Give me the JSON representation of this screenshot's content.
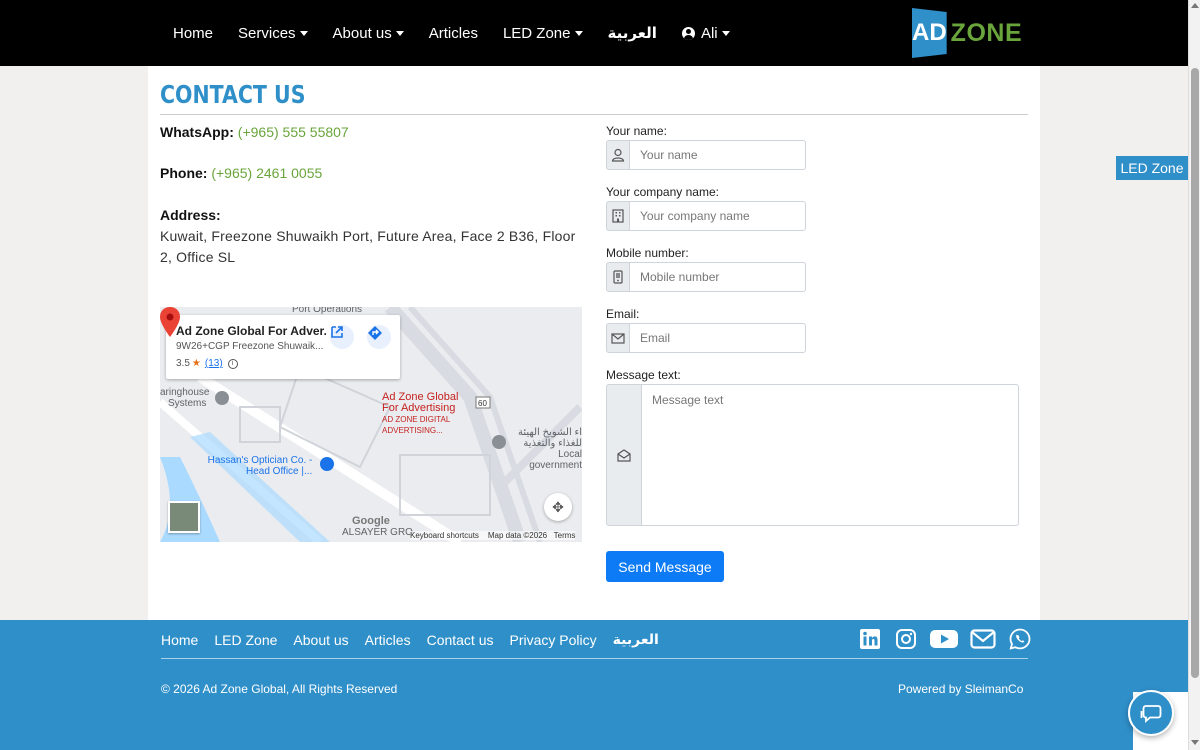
{
  "nav": {
    "items": [
      {
        "label": "Home",
        "dropdown": false
      },
      {
        "label": "Services",
        "dropdown": true
      },
      {
        "label": "About us",
        "dropdown": true
      },
      {
        "label": "Articles",
        "dropdown": false
      },
      {
        "label": "LED Zone",
        "dropdown": true
      },
      {
        "label": "العربية",
        "dropdown": false
      }
    ],
    "user": {
      "label": "Ali"
    },
    "logo": {
      "part1": "AD",
      "part2": "ZONE"
    }
  },
  "page": {
    "title": "CONTACT US",
    "whatsapp": {
      "label": "WhatsApp:",
      "value": "(+965) 555 55807"
    },
    "phone": {
      "label": "Phone:",
      "value": "(+965) 2461 0055"
    },
    "address": {
      "label": "Address:",
      "value": "Kuwait, Freezone Shuwaikh Port, Future Area, Face 2 B36, Floor 2, Office SL"
    }
  },
  "map": {
    "card_title": "Ad Zone Global For Adver...",
    "card_address": "9W26+CGP Freezone Shuwaik...",
    "rating": "3.5",
    "reviews": "(13)",
    "business_label_1": "Ad Zone Global",
    "business_label_2": "For Advertising",
    "business_sub_1": "AD ZONE DIGITAL",
    "business_sub_2": "ADVERTISING...",
    "label_clearing": "aringhouse",
    "label_systems": "Systems",
    "label_hassan_1": "Hassan's Optician Co. -",
    "label_hassan_2": "Head Office |...",
    "label_arabic_1": "اء الشويخ الهيئة",
    "label_arabic_2": "للغذاء والتغذية",
    "label_local": "Local government",
    "label_alsayer": "ALSAYER GRO",
    "label_port": "Port Operations",
    "road_number": "60",
    "google": "Google",
    "footer_shortcuts": "Keyboard shortcuts",
    "footer_data": "Map data ©2026",
    "footer_terms": "Terms"
  },
  "form": {
    "name": {
      "label": "Your name:",
      "placeholder": "Your name"
    },
    "company": {
      "label": "Your company name:",
      "placeholder": "Your company name"
    },
    "mobile": {
      "label": "Mobile number:",
      "placeholder": "Mobile number"
    },
    "email": {
      "label": "Email:",
      "placeholder": "Email"
    },
    "message": {
      "label": "Message text:",
      "placeholder": "Message text"
    },
    "submit": "Send Message"
  },
  "led_tab": "LED Zone",
  "footer": {
    "links": [
      "Home",
      "LED Zone",
      "About us",
      "Articles",
      "Contact us",
      "Privacy Policy",
      "العربية"
    ],
    "social": [
      "linkedin-icon",
      "instagram-icon",
      "youtube-icon",
      "mail-icon",
      "whatsapp-icon"
    ],
    "copyright": "© 2026 Ad Zone Global, All Rights Reserved",
    "powered": "Powered by SleimanCo"
  },
  "colors": {
    "brand_blue": "#2f8fc9",
    "accent_green": "#6aa53c",
    "button_blue": "#0d7bf5",
    "navbar": "#000000"
  }
}
